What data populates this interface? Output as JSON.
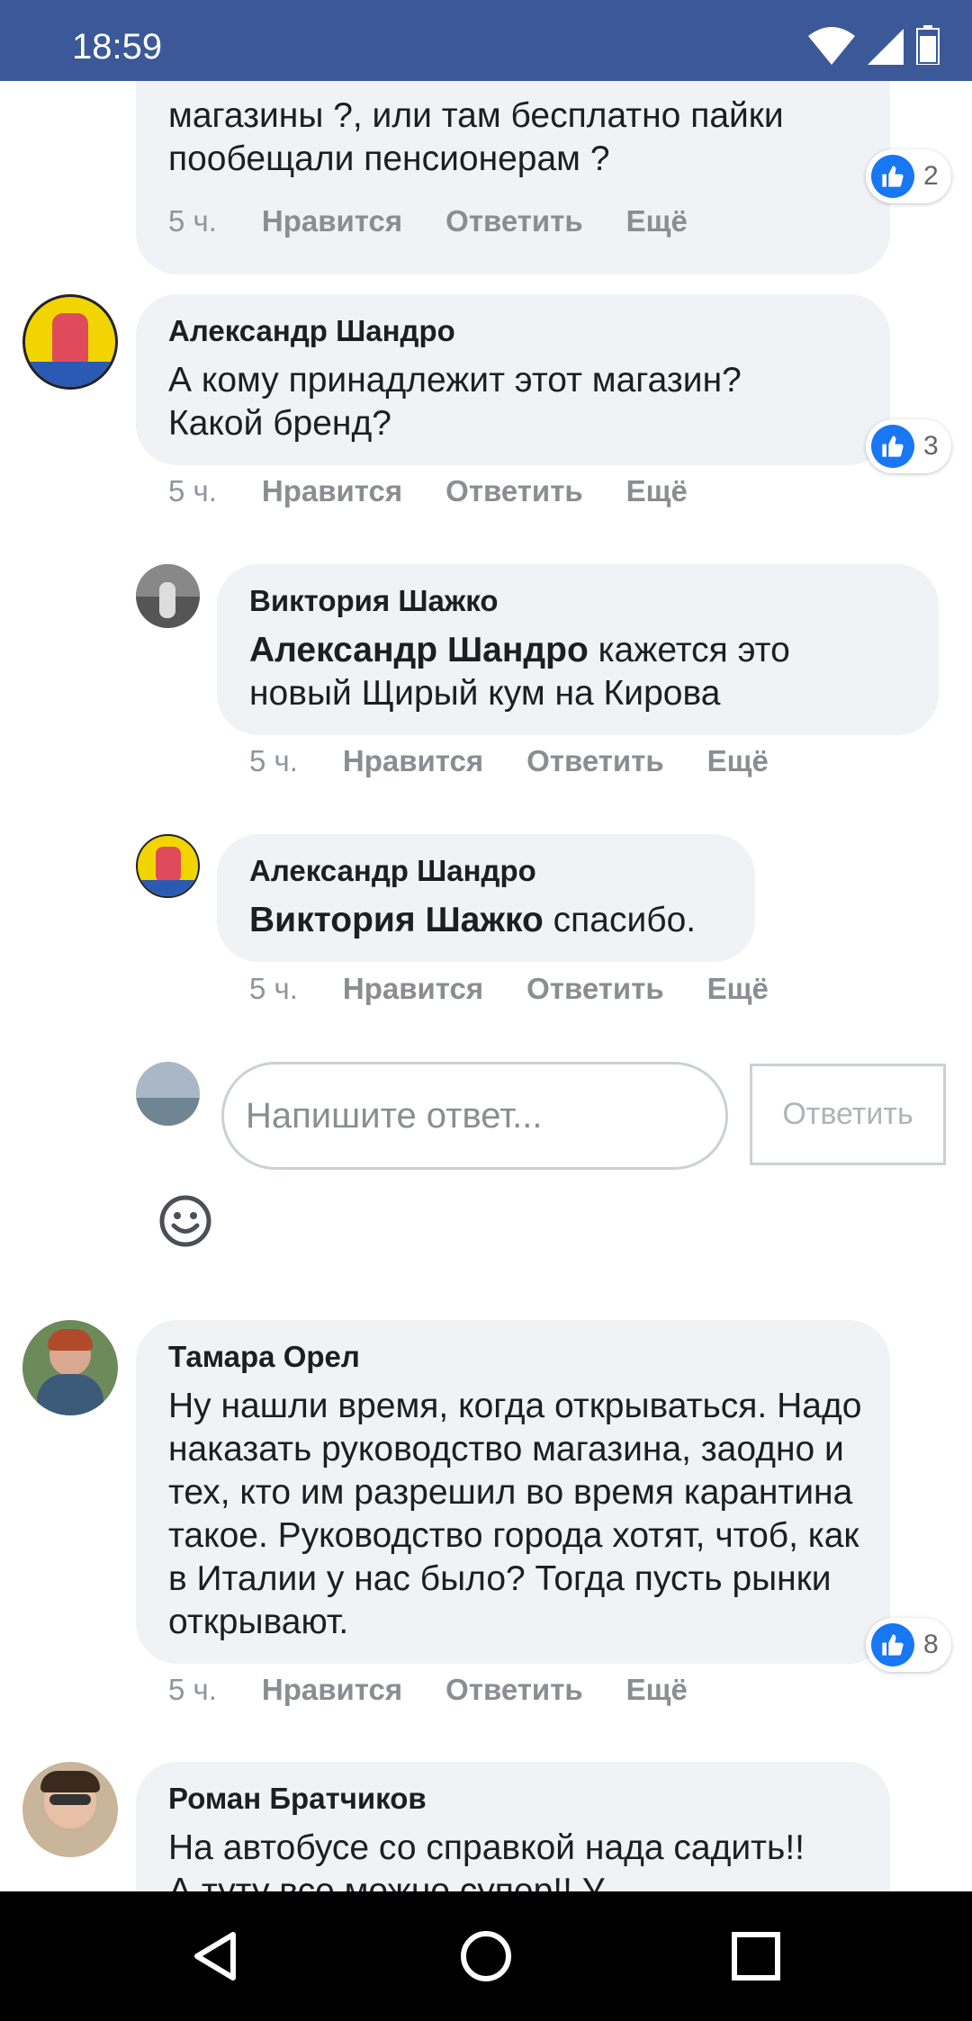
{
  "status_bar": {
    "time": "18:59"
  },
  "comments": [
    {
      "text": "магазины ?, или там бесплатно пайки пообещали пенсионерам ?",
      "likes": "2",
      "time": "5 ч.",
      "actions": {
        "like": "Нравится",
        "reply": "Ответить",
        "more": "Ещё"
      }
    },
    {
      "author": "Александр Шандро",
      "text": "А кому принадлежит этот магазин? Какой бренд?",
      "likes": "3",
      "time": "5 ч.",
      "actions": {
        "like": "Нравится",
        "reply": "Ответить",
        "more": "Ещё"
      },
      "replies": [
        {
          "author": "Виктория Шажко",
          "mention": "Александр Шандро",
          "text": " кажется это новый Щирый кум на Кирова",
          "time": "5 ч.",
          "actions": {
            "like": "Нравится",
            "reply": "Ответить",
            "more": "Ещё"
          }
        },
        {
          "author": "Александр Шандро",
          "mention": "Виктория Шажко",
          "text": " спасибо.",
          "time": "5 ч.",
          "actions": {
            "like": "Нравится",
            "reply": "Ответить",
            "more": "Ещё"
          }
        }
      ]
    },
    {
      "author": "Тамара Орел",
      "text": "Ну нашли время, когда открываться. Надо наказать руководство магазина, заодно и тех, кто им разрешил во время карантина такое. Руководство города хотят, чтоб, как в Италии у нас было? Тогда пусть рынки открывают.",
      "likes": "8",
      "time": "5 ч.",
      "actions": {
        "like": "Нравится",
        "reply": "Ответить",
        "more": "Ещё"
      }
    },
    {
      "author": "Роман Братчиков",
      "text": "На автобусе со справкой нада садить!! А туту все можно супер!! У"
    }
  ],
  "reply_box": {
    "placeholder": "Напишите ответ...",
    "button": "Ответить"
  },
  "colors": {
    "status_bar": "#3b5998",
    "bubble": "#f0f2f5",
    "like": "#1877f2"
  },
  "icons": [
    "wifi-icon",
    "signal-icon",
    "battery-icon",
    "like-icon",
    "emoji-icon",
    "back-icon",
    "home-icon",
    "recents-icon"
  ]
}
